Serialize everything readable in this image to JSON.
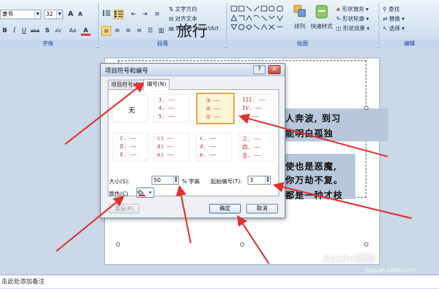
{
  "ribbon": {
    "font": {
      "name_value": "隶书",
      "size_value": "32",
      "grow_glyph": "A",
      "shrink_glyph": "A",
      "bold": "B",
      "italic": "I",
      "underline": "U",
      "strike": "abe",
      "shadow": "S",
      "spacing": "AV",
      "case": "Aa",
      "color": "A",
      "group_label": "字体"
    },
    "paragraph": {
      "text_direction": "文字方向",
      "align_text": "对齐文本",
      "convert_smartart": "转换为 SmartArt",
      "group_label": "段落"
    },
    "drawing": {
      "arrange": "排列",
      "quick_styles": "快速样式",
      "shape_fill": "形状填充",
      "shape_outline": "形状轮廓",
      "shape_effects": "形状效果",
      "group_label": "绘图"
    },
    "editing": {
      "find": "查找",
      "replace": "替换",
      "select": "选择",
      "group_label": "编辑"
    }
  },
  "slide": {
    "title_fragment": "旅行",
    "lines": [
      "人奔波, 到习",
      "能明白孤独",
      "使也是恶魔,",
      "你万劫不复。",
      "都是一种才枝"
    ]
  },
  "notes_placeholder": "击此处添加备注",
  "dialog": {
    "title": "项目符号和编号",
    "help": "?",
    "close": "X",
    "tabs": [
      {
        "label": "项目符号(B)"
      },
      {
        "label": "编号(N)"
      }
    ],
    "none_label": "无",
    "grid": [
      {
        "items": []
      },
      {
        "items": [
          "3.",
          "4.",
          "5."
        ]
      },
      {
        "items": [
          "③",
          "④",
          "⑤"
        ]
      },
      {
        "items": [
          "III.",
          "IV.",
          "V."
        ]
      },
      {
        "items": [
          "C.",
          "D.",
          "E."
        ]
      },
      {
        "items": [
          "c)",
          "d)",
          "e)"
        ]
      },
      {
        "items": [
          "c.",
          "d.",
          "e."
        ]
      },
      {
        "items": [
          "三.",
          "四.",
          "五."
        ]
      }
    ],
    "size_label": "大小(S):",
    "size_value": "50",
    "size_unit": "% 字高",
    "start_label": "起始编号(T):",
    "start_value": "3",
    "color_label": "颜色(C)",
    "reset_label": "重设(R)",
    "ok_label": "确定",
    "cancel_label": "取消"
  },
  "watermark": {
    "brand": "Baidu经验",
    "url": "jingyan.baidu.com"
  },
  "colors": {
    "accent_red": "#e03030",
    "number_red": "#c0323a",
    "selected_orange": "#e3a23a"
  }
}
